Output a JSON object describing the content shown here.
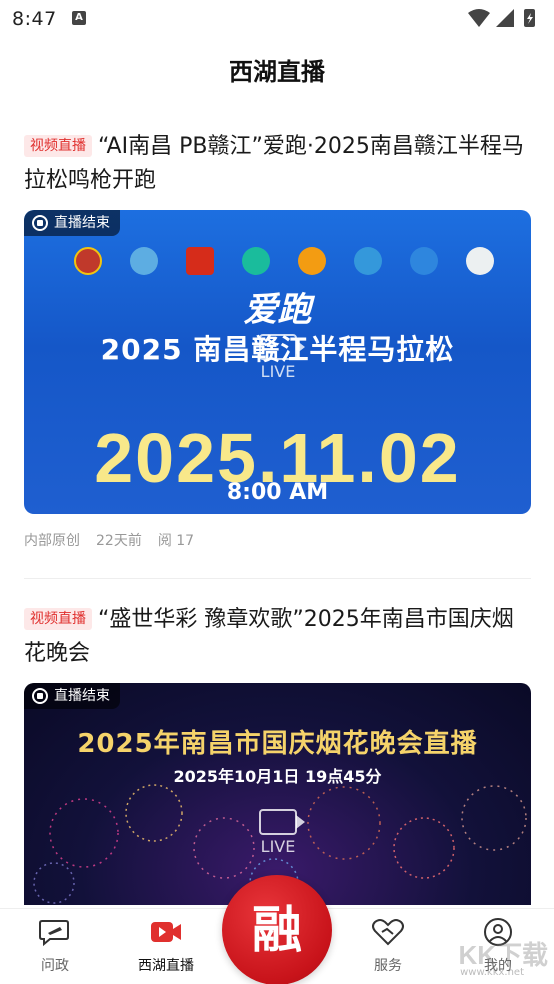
{
  "status_bar": {
    "time": "8:47",
    "notification_glyph": "A"
  },
  "header": {
    "title": "西湖直播"
  },
  "feed": [
    {
      "badge": "视频直播",
      "title": "“AI南昌 PB赣江”爱跑·2025南昌赣江半程马拉松鸣枪开跑",
      "live_status": "直播结束",
      "poster_line1": "爱跑",
      "poster_line2": "2025 南昌赣江半程马拉松",
      "poster_date": "2025.11.02",
      "poster_time": "8:00 AM",
      "live_label": "LIVE",
      "source": "内部原创",
      "time_ago": "22天前",
      "reads": "阅 17"
    },
    {
      "badge": "视频直播",
      "title": "“盛世华彩 豫章欢歌”2025年南昌市国庆烟花晚会",
      "live_status": "直播结束",
      "poster_title": "2025年南昌市国庆烟花晚会直播",
      "poster_sub": "2025年10月1日 19点45分",
      "live_label": "LIVE"
    }
  ],
  "tab_bar": {
    "tabs": [
      {
        "label": "问政",
        "icon": "chat-edit-icon"
      },
      {
        "label": "西湖直播",
        "icon": "video-camera-icon",
        "active": true
      },
      {
        "label": "融",
        "icon": "center-logo"
      },
      {
        "label": "服务",
        "icon": "heart-handshake-icon"
      },
      {
        "label": "我的",
        "icon": "user-icon"
      }
    ]
  },
  "watermark": {
    "text": "KK下载",
    "sub": "www.kkx.net"
  },
  "colors": {
    "accent": "#e0302e",
    "badge_bg": "#fde8e8",
    "center_button": "#c8131a"
  }
}
